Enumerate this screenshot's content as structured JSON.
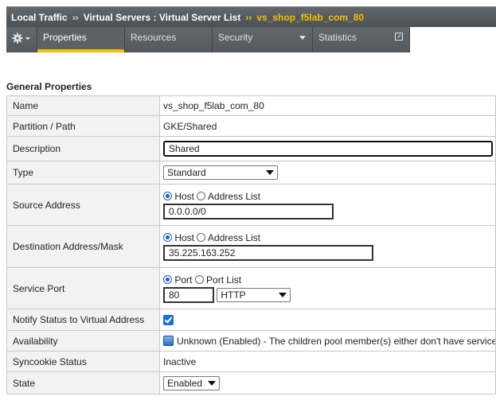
{
  "breadcrumb": {
    "root": "Local Traffic",
    "sep1": "››",
    "section": "Virtual Servers : Virtual Server List",
    "sep2": "››",
    "current": "vs_shop_f5lab_com_80"
  },
  "tabs": [
    {
      "label": "Properties",
      "active": true
    },
    {
      "label": "Resources"
    },
    {
      "label": "Security",
      "has_dropdown": true
    },
    {
      "label": "Statistics",
      "has_external_icon": true
    }
  ],
  "section_title": "General Properties",
  "rows": {
    "name": {
      "label": "Name",
      "value": "vs_shop_f5lab_com_80"
    },
    "partition": {
      "label": "Partition / Path",
      "value": "GKE/Shared"
    },
    "description": {
      "label": "Description",
      "value": "Shared"
    },
    "type": {
      "label": "Type",
      "value": "Standard"
    },
    "source": {
      "label": "Source Address",
      "opt_host": "Host",
      "opt_list": "Address List",
      "value": "0.0.0.0/0"
    },
    "destination": {
      "label": "Destination Address/Mask",
      "opt_host": "Host",
      "opt_list": "Address List",
      "value": "35.225.163.252"
    },
    "service_port": {
      "label": "Service Port",
      "opt_port": "Port",
      "opt_list": "Port List",
      "port_value": "80",
      "protocol": "HTTP"
    },
    "notify": {
      "label": "Notify Status to Virtual Address",
      "checked": true
    },
    "availability": {
      "label": "Availability",
      "value": "Unknown (Enabled) - The children pool member(s) either don't have service"
    },
    "syncookie": {
      "label": "Syncookie Status",
      "value": "Inactive"
    },
    "state": {
      "label": "State",
      "value": "Enabled"
    }
  },
  "colors": {
    "accent": "#f2c200",
    "tabbar": "#5a5f64",
    "radio": "#1a5fc8",
    "checkbox": "#1a6fd6"
  }
}
